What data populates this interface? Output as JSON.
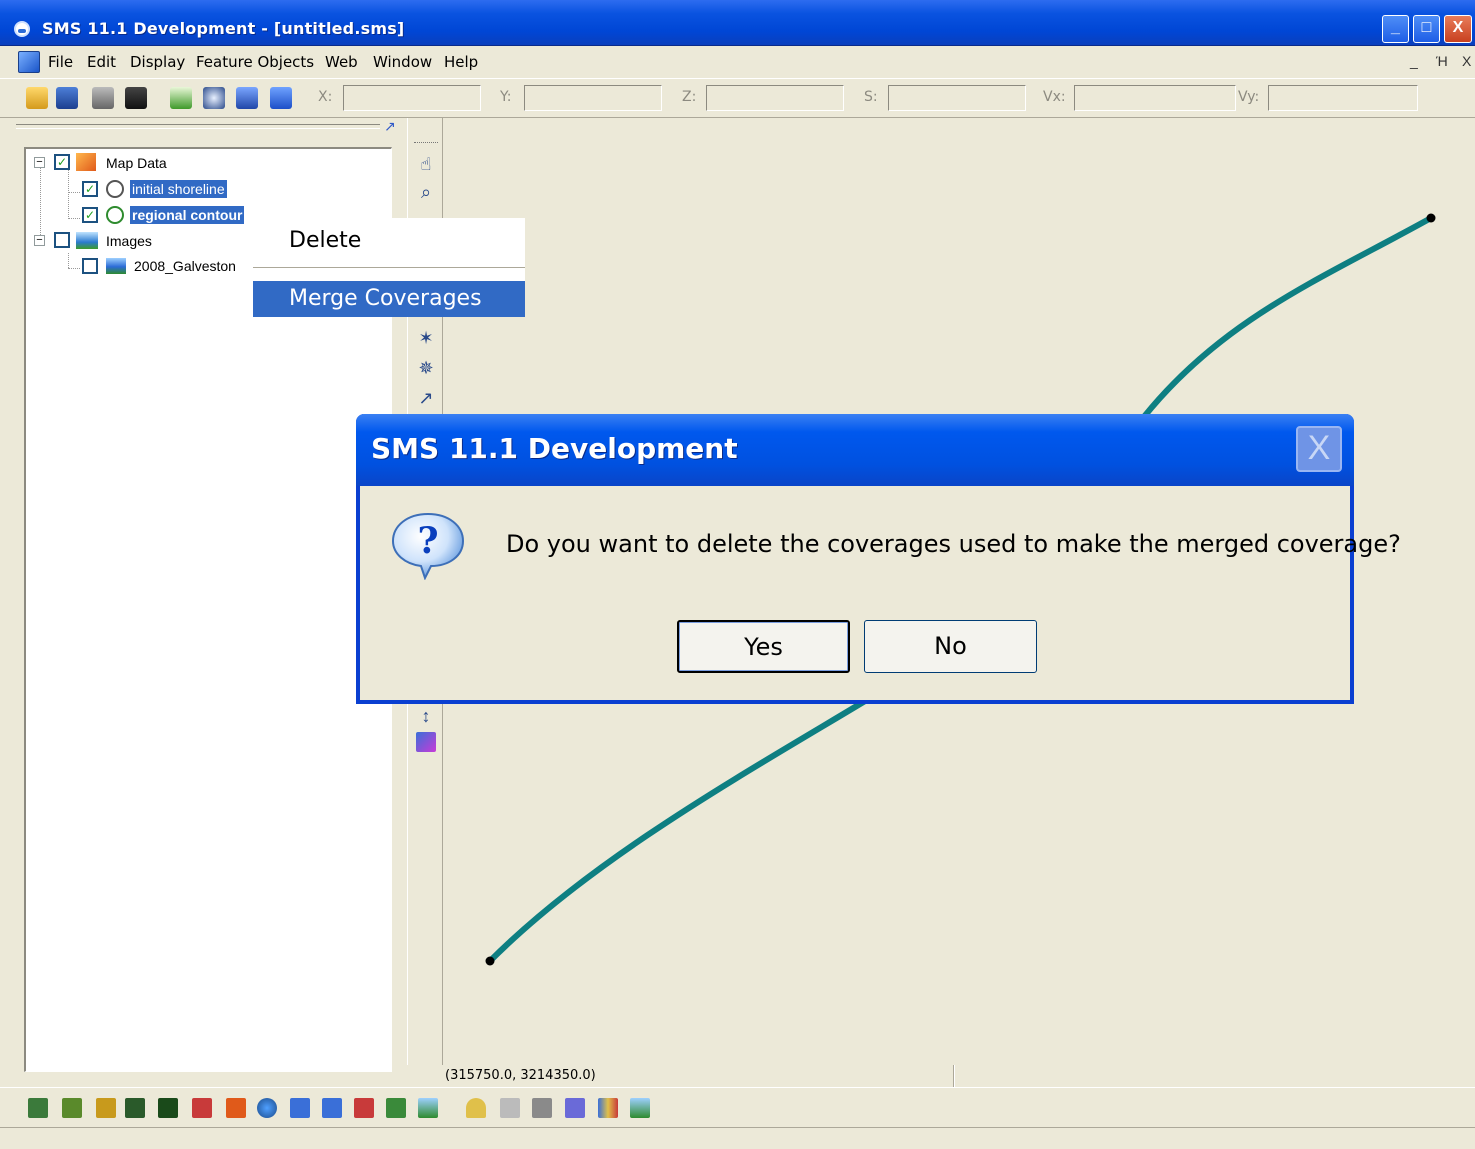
{
  "window": {
    "title": "SMS 11.1 Development - [untitled.sms]",
    "controls": {
      "minimize": "_",
      "maximize": "□",
      "close": "X"
    }
  },
  "menubar": {
    "items": [
      "File",
      "Edit",
      "Display",
      "Feature Objects",
      "Web",
      "Window",
      "Help"
    ],
    "mdi_controls": [
      "_",
      "Ή",
      "X"
    ]
  },
  "toolbar": {
    "coord_labels": [
      "X:",
      "Y:",
      "Z:",
      "S:",
      "Vx:",
      "Vy:"
    ],
    "coord_values": [
      "",
      "",
      "",
      "",
      "",
      ""
    ]
  },
  "tree": {
    "map_data": {
      "label": "Map Data",
      "checked": true,
      "expander": "−"
    },
    "coverages": [
      {
        "label": "initial shoreline",
        "checked": true,
        "selected": true
      },
      {
        "label": "regional contour",
        "checked": true,
        "selected": true
      }
    ],
    "images": {
      "label": "Images",
      "checked": false,
      "expander": "−"
    },
    "image_items": [
      {
        "label": "2008_Galveston",
        "checked": false
      }
    ]
  },
  "context_menu": {
    "items": [
      "Delete",
      "Merge Coverages"
    ],
    "highlighted": "Merge Coverages"
  },
  "dialog": {
    "title": "SMS 11.1 Development",
    "message": "Do you want to delete the coverages used to make the merged coverage?",
    "icon": "question-icon",
    "buttons": {
      "yes": "Yes",
      "no": "No"
    },
    "close": "X"
  },
  "statusbar": {
    "coords": "(315750.0, 3214350.0)"
  },
  "colors": {
    "arc": "#0e7f82",
    "selection": "#316ac5",
    "titlebar": "#0a53e0"
  }
}
